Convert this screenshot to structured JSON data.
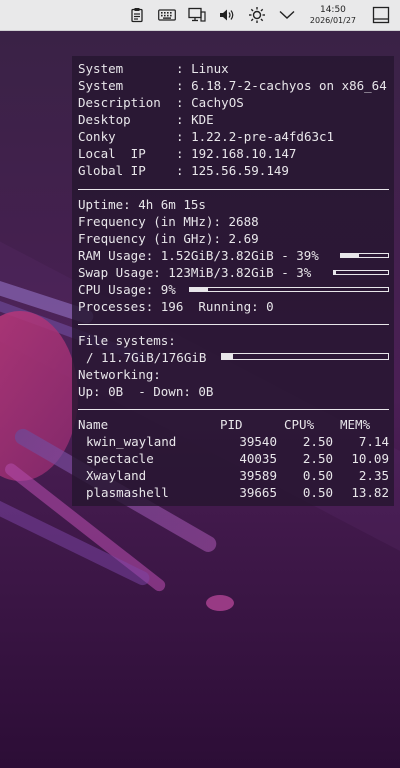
{
  "taskbar": {
    "time": "14:50",
    "date": "2026/01/27",
    "icons": [
      "clipboard-icon",
      "keyboard-icon",
      "display-config-icon",
      "volume-icon",
      "brightness-icon",
      "chevron-down-icon",
      "show-desktop-icon"
    ]
  },
  "conky": {
    "system_info": [
      {
        "label": "System",
        "value": "Linux"
      },
      {
        "label": "System",
        "value": "6.18.7-2-cachyos on x86_64"
      },
      {
        "label": "Description",
        "value": "CachyOS"
      },
      {
        "label": "Desktop",
        "value": "KDE"
      },
      {
        "label": "Conky",
        "value": "1.22.2-pre-a4fd63c1"
      },
      {
        "label": "Local  IP",
        "value": "192.168.10.147"
      },
      {
        "label": "Global IP",
        "value": "125.56.59.149"
      }
    ],
    "uptime": "Uptime: 4h 6m 15s",
    "freq_mhz": "Frequency (in MHz): 2688",
    "freq_ghz": "Frequency (in GHz): 2.69",
    "ram": {
      "text": "RAM Usage: 1.52GiB/3.82GiB - 39%",
      "percent": 39
    },
    "swap": {
      "text": "Swap Usage: 123MiB/3.82GiB - 3%",
      "percent": 3
    },
    "cpu": {
      "text": "CPU Usage: 9%",
      "percent": 9
    },
    "processes": "Processes: 196  Running: 0",
    "filesystems_label": "File systems:",
    "root_fs": {
      "text": "/ 11.7GiB/176GiB",
      "percent": 6.6
    },
    "networking_label": "Networking:",
    "network": "Up: 0B  - Down: 0B",
    "process_table": {
      "headers": [
        "Name",
        "PID",
        "CPU%",
        "MEM%"
      ],
      "rows": [
        [
          "kwin_wayland",
          "39540",
          "2.50",
          "7.14"
        ],
        [
          "spectacle",
          "40035",
          "2.50",
          "10.09"
        ],
        [
          "Xwayland",
          "39589",
          "0.50",
          "2.35"
        ],
        [
          "plasmashell",
          "39665",
          "0.50",
          "13.82"
        ]
      ]
    }
  }
}
